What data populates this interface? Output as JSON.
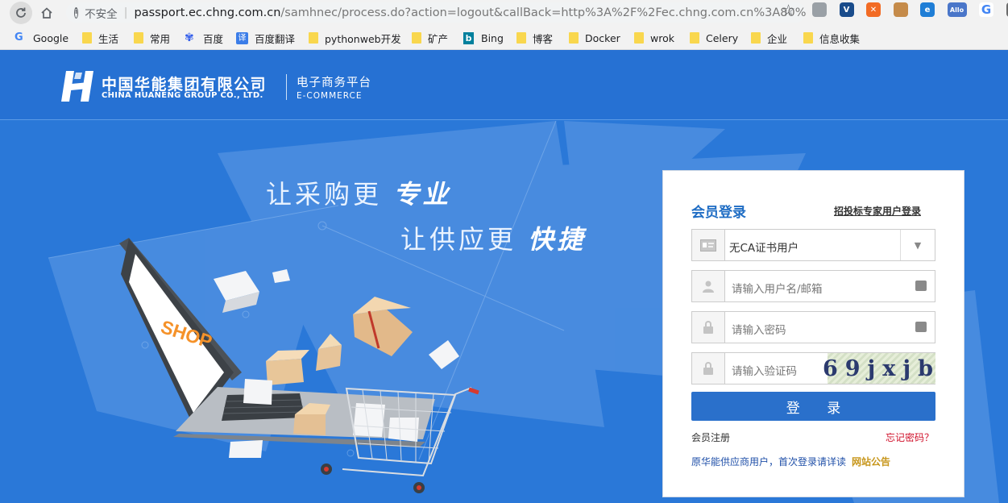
{
  "browser": {
    "security_label": "不安全",
    "url_host": "passport.ec.chng.com.cn",
    "url_path": "/samhnec/process.do?action=logout&callBack=http%3A%2F%2Fec.chng.com.cn%3A80%2...",
    "extensions": [
      {
        "icon": "shield-ext-icon",
        "color": "#9aa0a6",
        "label": ""
      },
      {
        "icon": "v-ext-icon",
        "color": "#1a4c8b",
        "label": "V"
      },
      {
        "icon": "x-ext-icon",
        "color": "#f26b24",
        "label": "✕"
      },
      {
        "icon": "cookie-ext-icon",
        "color": "#c58b4a",
        "label": ""
      },
      {
        "icon": "e-ext-icon",
        "color": "#1f7ed6",
        "label": "e"
      },
      {
        "icon": "allo-ext-icon",
        "color": "#4a76c9",
        "label": "Allo"
      },
      {
        "icon": "google-ext-icon",
        "color": "#ffffff",
        "label": "G"
      },
      {
        "icon": "screen-ext-icon",
        "color": "#6b6b6b",
        "label": ""
      }
    ]
  },
  "bookmarks": [
    {
      "label": "Google",
      "icon": "google"
    },
    {
      "label": "生活",
      "icon": "folder"
    },
    {
      "label": "常用",
      "icon": "folder"
    },
    {
      "label": "百度",
      "icon": "baidu"
    },
    {
      "label": "百度翻译",
      "icon": "translate"
    },
    {
      "label": "pythonweb开发",
      "icon": "folder"
    },
    {
      "label": "矿产",
      "icon": "folder"
    },
    {
      "label": "Bing",
      "icon": "bing"
    },
    {
      "label": "博客",
      "icon": "folder"
    },
    {
      "label": "Docker",
      "icon": "folder"
    },
    {
      "label": "wrok",
      "icon": "folder"
    },
    {
      "label": "Celery",
      "icon": "folder"
    },
    {
      "label": "企业",
      "icon": "folder"
    },
    {
      "label": "信息收集",
      "icon": "folder"
    }
  ],
  "header": {
    "company_cn": "中国华能集团有限公司",
    "company_en": "CHINA HUANENG GROUP CO., LTD.",
    "platform_cn": "电子商务平台",
    "platform_en": "E-COMMERCE"
  },
  "slogan": {
    "line1_prefix": "让采购更",
    "line1_emph": "专业",
    "line2_prefix": "让供应更",
    "line2_emph": "快捷"
  },
  "illustration": {
    "screen_text": "SHOP"
  },
  "login": {
    "title": "会员登录",
    "expert_link": "招投标专家用户登录",
    "account_type": "无CA证书用户",
    "username_placeholder": "请输入用户名/邮箱",
    "password_placeholder": "请输入密码",
    "captcha_placeholder": "请输入验证码",
    "captcha_text": "69jxjb",
    "submit": "登 录",
    "register": "会员注册",
    "forgot": "忘记密码？",
    "notice": "原华能供应商用户，首次登录请详读",
    "announcement": "网站公告"
  }
}
